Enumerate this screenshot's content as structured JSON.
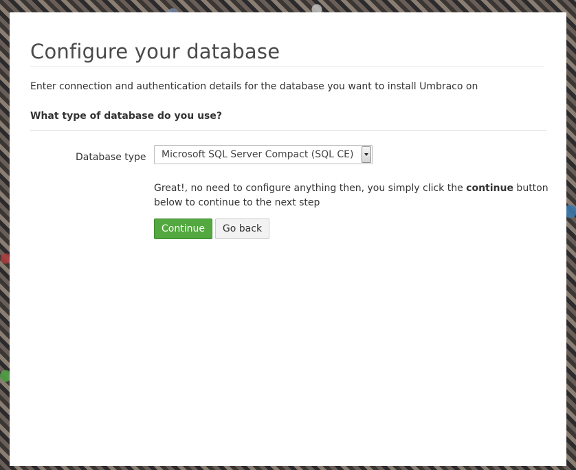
{
  "page": {
    "title": "Configure your database",
    "intro": "Enter connection and authentication details for the database you want to install Umbraco on"
  },
  "form": {
    "question": "What type of database do you use?",
    "db_type_label": "Database type",
    "db_type_selected": "Microsoft SQL Server Compact (SQL CE)",
    "info_prefix": "Great!, no need to configure anything then, you simply click the ",
    "info_bold": "continue",
    "info_suffix": " button below to continue to the next step"
  },
  "buttons": {
    "continue_label": "Continue",
    "back_label": "Go back"
  },
  "colors": {
    "continue_bg": "#53a93f",
    "panel_bg": "#ffffff"
  }
}
